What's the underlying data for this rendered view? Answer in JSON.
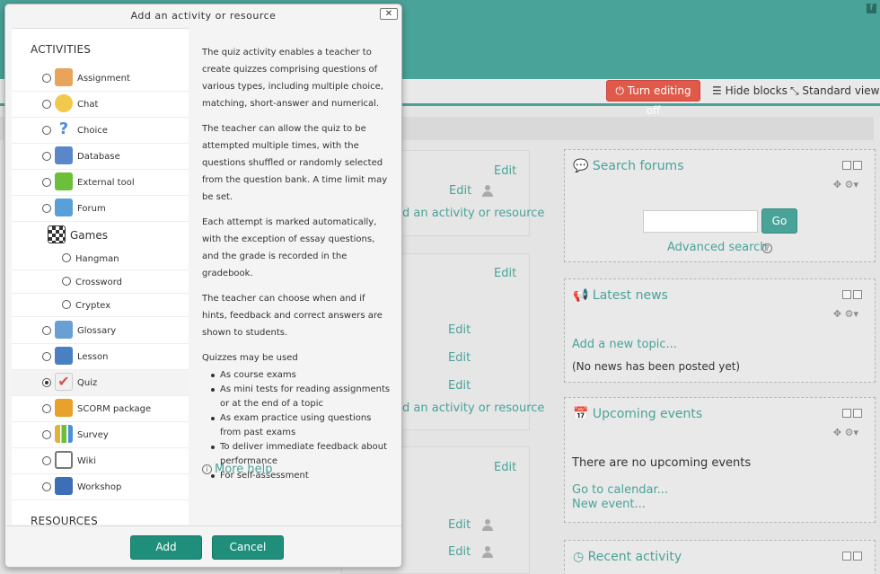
{
  "topbar": {
    "facebook_icon": "facebook-icon",
    "facebook_letter": "f"
  },
  "toolbar": {
    "turn_editing": "Turn editing off",
    "hide_blocks": "Hide blocks",
    "standard_view": "Standard view"
  },
  "main": {
    "edit": "Edit",
    "add_activity": "d an activity or resource"
  },
  "blocks": {
    "search": {
      "title": "Search forums",
      "go": "Go",
      "advanced": "Advanced search"
    },
    "news": {
      "title": "Latest news",
      "add_topic": "Add a new topic...",
      "empty": "(No news has been posted yet)"
    },
    "events": {
      "title": "Upcoming events",
      "empty": "There are no upcoming events",
      "goto_calendar": "Go to calendar...",
      "new_event": "New event..."
    },
    "recent": {
      "title": "Recent activity"
    }
  },
  "modal": {
    "title": "Add an activity or resource",
    "close": "✕",
    "activities_label": "ACTIVITIES",
    "resources_label": "RESOURCES",
    "options": [
      {
        "label": "Assignment",
        "icon": "assignment-icon",
        "color": "#e7a45a"
      },
      {
        "label": "Chat",
        "icon": "chat-icon",
        "color": "#f2c94c"
      },
      {
        "label": "Choice",
        "icon": "choice-icon",
        "color": "#4a8fd9"
      },
      {
        "label": "Database",
        "icon": "database-icon",
        "color": "#5b86c9"
      },
      {
        "label": "External tool",
        "icon": "puzzle-icon",
        "color": "#6cbf3a"
      },
      {
        "label": "Forum",
        "icon": "forum-icon",
        "color": "#5aa0d8"
      }
    ],
    "games": {
      "label": "Games",
      "icon": "checkerboard-icon",
      "items": [
        "Hangman",
        "Crossword",
        "Cryptex"
      ]
    },
    "options2": [
      {
        "label": "Glossary",
        "icon": "glossary-icon",
        "color": "#6a9fd4"
      },
      {
        "label": "Lesson",
        "icon": "lesson-icon",
        "color": "#4a7fc1"
      },
      {
        "label": "Quiz",
        "icon": "quiz-icon",
        "color": "#d9534f",
        "selected": true
      },
      {
        "label": "SCORM package",
        "icon": "scorm-icon",
        "color": "#e8a22c"
      },
      {
        "label": "Survey",
        "icon": "survey-icon",
        "color": "#e0b43a"
      },
      {
        "label": "Wiki",
        "icon": "wiki-icon",
        "color": "#777777"
      },
      {
        "label": "Workshop",
        "icon": "workshop-icon",
        "color": "#3d6fb6"
      }
    ],
    "help": {
      "p1": "The quiz activity enables a teacher to create quizzes comprising questions of various types, including multiple choice, matching, short-answer and numerical.",
      "p2": "The teacher can allow the quiz to be attempted multiple times, with the questions shuffled or randomly selected from the question bank. A time limit may be set.",
      "p3": "Each attempt is marked automatically, with the exception of essay questions, and the grade is recorded in the gradebook.",
      "p4": "The teacher can choose when and if hints, feedback and correct answers are shown to students.",
      "p5": "Quizzes may be used",
      "bullets": [
        "As course exams",
        "As mini tests for reading assignments or at the end of a topic",
        "As exam practice using questions from past exams",
        "To deliver immediate feedback about performance",
        "For self-assessment"
      ],
      "more_help": "More help"
    },
    "add": "Add",
    "cancel": "Cancel"
  }
}
